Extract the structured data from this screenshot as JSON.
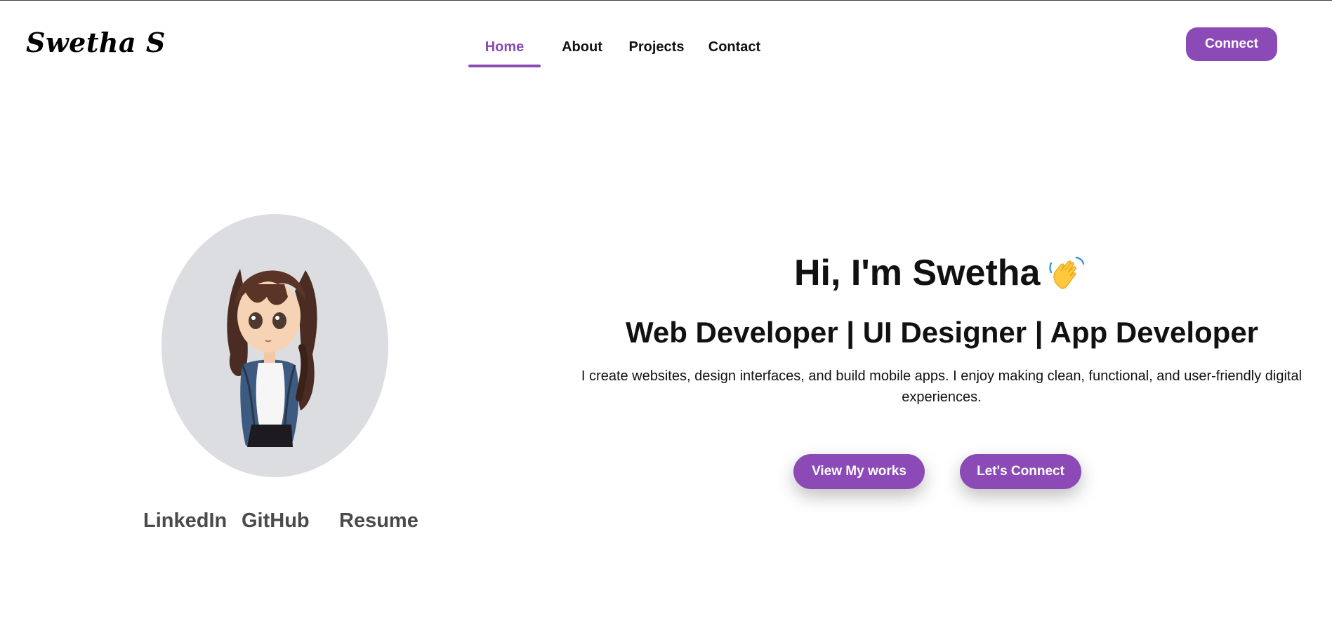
{
  "header": {
    "logo": "Swetha S",
    "nav": [
      {
        "label": "Home",
        "active": true
      },
      {
        "label": "About",
        "active": false
      },
      {
        "label": "Projects",
        "active": false
      },
      {
        "label": "Contact",
        "active": false
      }
    ],
    "connect_label": "Connect"
  },
  "hero": {
    "title": "Hi, I'm Swetha",
    "title_icon": "waving-hand-icon",
    "subtitle": "Web Developer | UI Designer | App Developer",
    "description": "I create websites, design interfaces, and build mobile apps. I enjoy making clean, functional, and user-friendly digital experiences.",
    "buttons": {
      "works": "View My works",
      "connect": "Let's Connect"
    }
  },
  "profile": {
    "image": "cartoon-girl-avatar",
    "links": [
      "LinkedIn",
      "GitHub",
      "Resume"
    ]
  },
  "colors": {
    "accent": "#8b4ab5",
    "avatar_bg": "#dcdde1",
    "link_text": "#4a4a4a"
  }
}
